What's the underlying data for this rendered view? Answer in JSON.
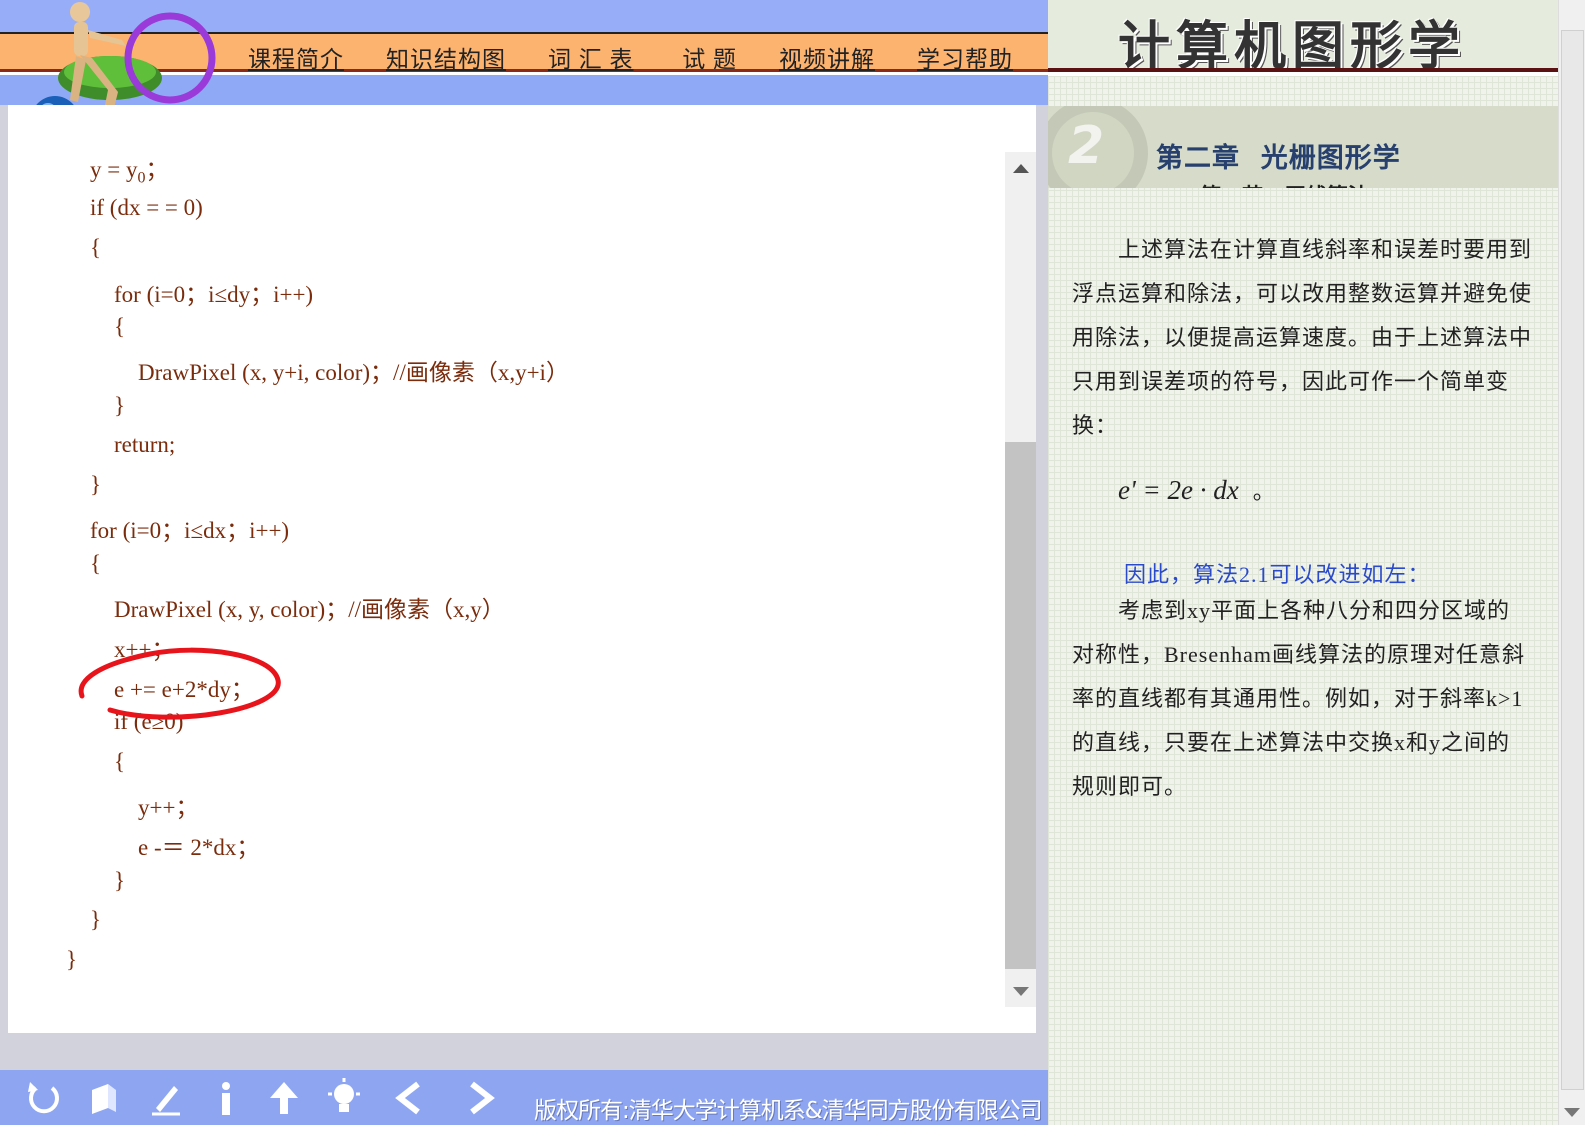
{
  "header": {
    "course_title": "计算机图形学",
    "nav": [
      {
        "label": "课程简介"
      },
      {
        "label": "知识结构图"
      },
      {
        "label": "词 汇 表"
      },
      {
        "label": " 试 题"
      },
      {
        "label": "视频讲解"
      },
      {
        "label": "学习帮助"
      }
    ]
  },
  "code": {
    "lines": [
      {
        "text": "y = y"
      },
      {
        "text": "if (dx = = 0)"
      },
      {
        "text": "{"
      },
      {
        "text": "for (i=0；i≤dy；i++)"
      },
      {
        "text": "{"
      },
      {
        "text": "DrawPixel (x, y+i, color)；//画像素（x,y+i）"
      },
      {
        "text": "}"
      },
      {
        "text": "return;"
      },
      {
        "text": "}"
      },
      {
        "text": "for (i=0；i≤dx；i++)"
      },
      {
        "text": "{"
      },
      {
        "text": "DrawPixel (x, y, color)；//画像素（x,y）"
      },
      {
        "text": "x++；"
      },
      {
        "text": "e += e+2*dy；"
      },
      {
        "text": "if (e≥0)"
      },
      {
        "text": "{"
      },
      {
        "text": "y++；"
      },
      {
        "text": "e -＝ 2*dx；"
      },
      {
        "text": "}"
      },
      {
        "text": "}"
      },
      {
        "text": "}"
      }
    ],
    "first_line_subscript": "0",
    "first_line_suffix": "；",
    "annotation_color": "#e8141c"
  },
  "right_panel": {
    "chapter_number": "2",
    "chapter_title": "第二章  光栅图形学",
    "section_title": "第一节   画线算法",
    "para1": "上述算法在计算直线斜率和误差时要用到浮点运算和除法，可以改用整数运算并避免使用除法，以便提高运算速度。由于上述算法中只用到误差项的符号，因此可作一个简单变换：",
    "formula": "e' = 2e · dx",
    "formula_suffix": "。",
    "link_text": "因此，算法2.1可以改进如左：",
    "para2": "考虑到xy平面上各种八分和四分区域的对称性，Bresenham画线算法的原理对任意斜率的直线都有其通用性。例如，对于斜率k>1的直线，只要在上述算法中交换x和y之间的规则即可。"
  },
  "footer": {
    "copyright": "版权所有:清华大学计算机系&清华同方股份有限公司",
    "buttons": [
      "refresh-icon",
      "book-icon",
      "pen-icon",
      "info-icon",
      "up-arrow-icon",
      "bulb-icon",
      "prev-icon",
      "next-icon"
    ]
  },
  "colors": {
    "code_text": "#7a2c0c",
    "nav_bar": "#fbb36f",
    "header_blue": "#97adf7",
    "link_blue": "#2a4acb"
  }
}
